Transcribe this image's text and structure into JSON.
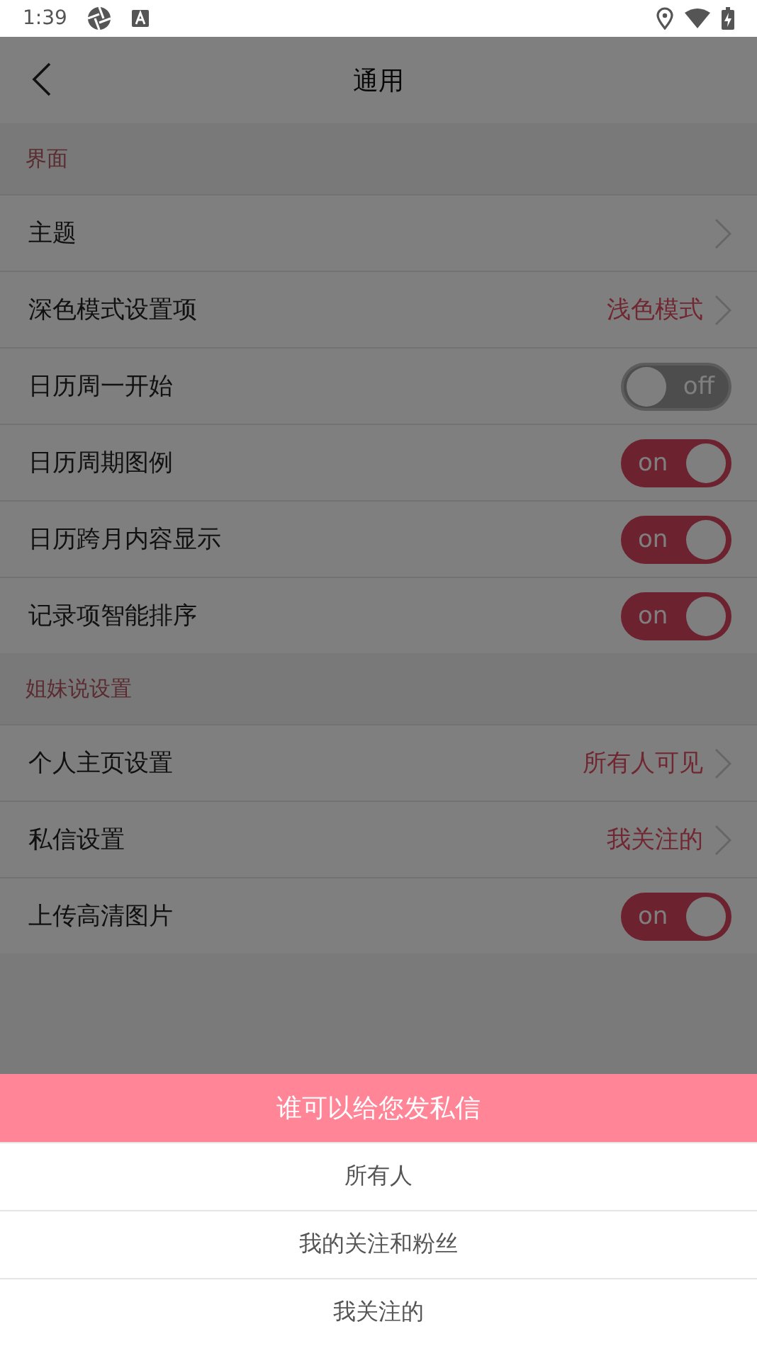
{
  "status_bar": {
    "time": "1:39"
  },
  "header": {
    "title": "通用"
  },
  "sections": [
    {
      "title": "界面",
      "rows": [
        {
          "kind": "link",
          "label": "主题"
        },
        {
          "kind": "link",
          "label": "深色模式设置项",
          "value": "浅色模式"
        },
        {
          "kind": "toggle",
          "label": "日历周一开始",
          "on": false,
          "toggle_text": "off"
        },
        {
          "kind": "toggle",
          "label": "日历周期图例",
          "on": true,
          "toggle_text": "on"
        },
        {
          "kind": "toggle",
          "label": "日历跨月内容显示",
          "on": true,
          "toggle_text": "on"
        },
        {
          "kind": "toggle",
          "label": "记录项智能排序",
          "on": true,
          "toggle_text": "on"
        }
      ]
    },
    {
      "title": "姐妹说设置",
      "rows": [
        {
          "kind": "link",
          "label": "个人主页设置",
          "value": "所有人可见"
        },
        {
          "kind": "link",
          "label": "私信设置",
          "value": "我关注的"
        },
        {
          "kind": "toggle",
          "label": "上传高清图片",
          "on": true,
          "toggle_text": "on"
        }
      ]
    }
  ],
  "sheet": {
    "title": "谁可以给您发私信",
    "options": [
      "所有人",
      "我的关注和粉丝",
      "我关注的"
    ]
  }
}
